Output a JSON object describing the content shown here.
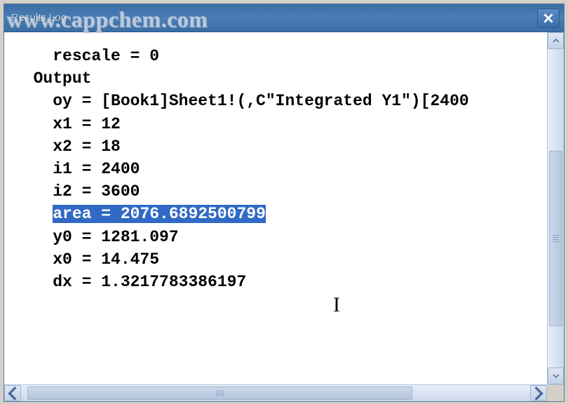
{
  "window": {
    "title": "Results Log"
  },
  "watermark": "www.cappchem.com",
  "output": {
    "lines": [
      {
        "indent": 4,
        "text": "rescale = 0",
        "highlighted": false
      },
      {
        "indent": 2,
        "text": "Output",
        "highlighted": false
      },
      {
        "indent": 4,
        "text": "oy = [Book1]Sheet1!(,C\"Integrated Y1\")[2400",
        "highlighted": false
      },
      {
        "indent": 4,
        "text": "x1 = 12",
        "highlighted": false
      },
      {
        "indent": 4,
        "text": "x2 = 18",
        "highlighted": false
      },
      {
        "indent": 4,
        "text": "i1 = 2400",
        "highlighted": false
      },
      {
        "indent": 4,
        "text": "i2 = 3600",
        "highlighted": false
      },
      {
        "indent": 4,
        "text": "area = 2076.6892500799",
        "highlighted": true
      },
      {
        "indent": 4,
        "text": "y0 = 1281.097",
        "highlighted": false
      },
      {
        "indent": 4,
        "text": "x0 = 14.475",
        "highlighted": false
      },
      {
        "indent": 4,
        "text": "dx = 1.3217783386197",
        "highlighted": false
      }
    ]
  }
}
